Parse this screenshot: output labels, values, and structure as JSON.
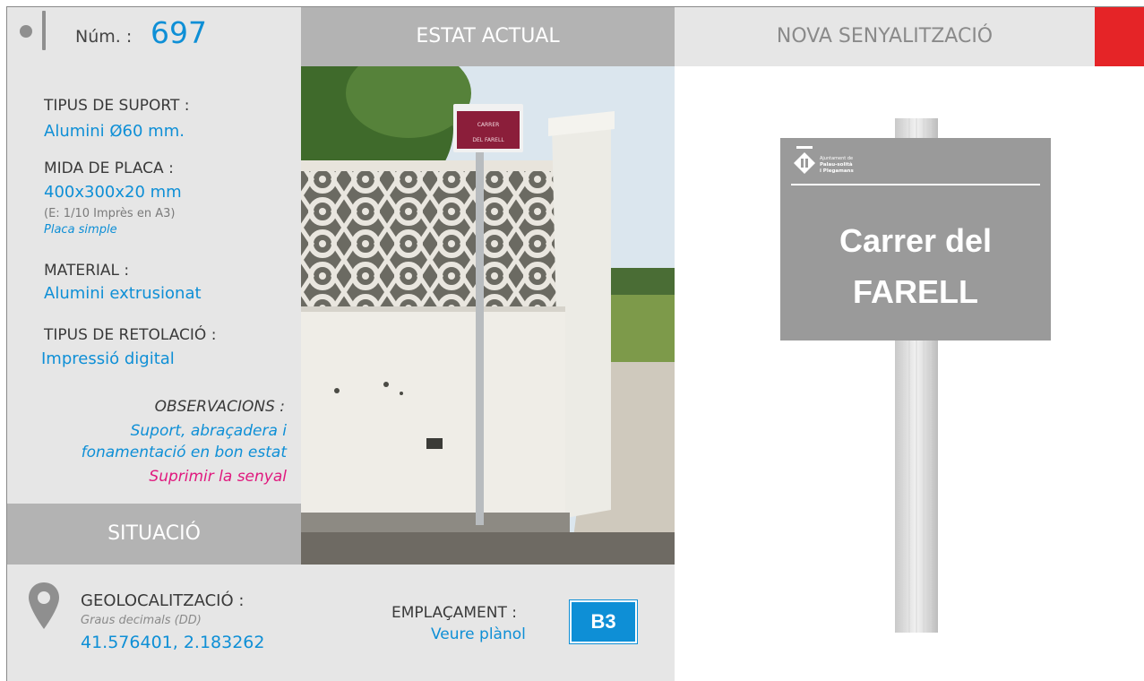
{
  "header": {
    "num_label": "Núm. :",
    "num_value": "697",
    "current_state": "ESTAT ACTUAL",
    "new_signage": "NOVA SENYALITZACIÓ",
    "accent_color": "#e52427"
  },
  "info": {
    "support_type_label": "TIPUS DE SUPORT :",
    "support_type_value": "Alumini Ø60 mm.",
    "plate_size_label": "MIDA DE PLACA :",
    "plate_size_value": "400x300x20 mm",
    "plate_scale_note": "(E: 1/10 Imprès en A3)",
    "plate_kind": "Placa simple",
    "material_label": "MATERIAL :",
    "material_value": "Alumini extrusionat",
    "lettering_label": "TIPUS DE RETOLACIÓ :",
    "lettering_value": "Impressió digital",
    "observations_label": "OBSERVACIONS :",
    "observations_line1": "Suport, abraçadera i",
    "observations_line2": "fonamentació en bon estat",
    "observations_action": "Suprimir la senyal"
  },
  "situation": {
    "title": "SITUACIÓ",
    "geo_label": "GEOLOCALITZACIÓ :",
    "geo_format": "Graus decimals (DD)",
    "geo_value": "41.576401, 2.183262",
    "placement_label": "EMPLAÇAMENT :",
    "placement_link": "Veure plànol",
    "placement_code": "B3"
  },
  "photo": {
    "sign_line1": "CARRER",
    "sign_line2": "DEL FARELL"
  },
  "new_sign": {
    "org_line1": "Ajuntament de",
    "org_line2": "Palau-solità",
    "org_line3": "i Plegamans",
    "street_line1": "Carrer del",
    "street_line2": "FARELL"
  },
  "colors": {
    "blue": "#0e8fd6",
    "pink": "#e0197e",
    "panel_gray": "#e6e6e6",
    "header_gray": "#b3b3b3",
    "sign_gray": "#9a9a9a"
  }
}
